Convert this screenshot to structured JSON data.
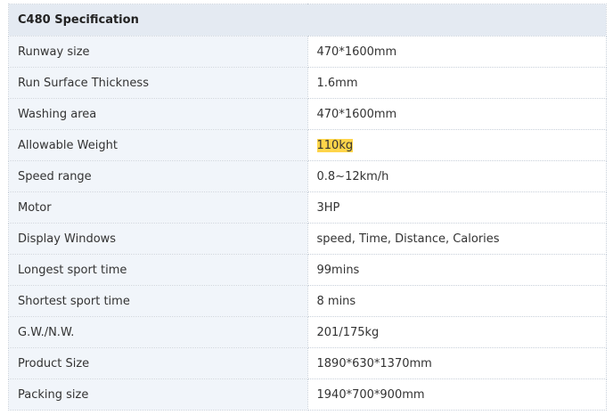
{
  "spec": {
    "title": "C480 Specification",
    "rows": [
      {
        "label": "Runway size",
        "value": "470*1600mm"
      },
      {
        "label": "Run Surface Thickness",
        "value": "1.6mm"
      },
      {
        "label": "Washing area",
        "value": "470*1600mm"
      },
      {
        "label": "Allowable Weight",
        "value": "110kg",
        "highlight": true
      },
      {
        "label": "Speed range",
        "value": "0.8~12km/h"
      },
      {
        "label": "Motor",
        "value": "3HP"
      },
      {
        "label": "Display Windows",
        "value": "speed, Time, Distance, Calories"
      },
      {
        "label": "Longest sport time",
        "value": "99mins"
      },
      {
        "label": "Shortest sport time",
        "value": "8 mins"
      },
      {
        "label": "G.W./N.W.",
        "value": "201/175kg"
      },
      {
        "label": "Product Size",
        "value": "1890*630*1370mm"
      },
      {
        "label": "Packing size",
        "value": "1940*700*900mm"
      }
    ]
  },
  "colors": {
    "header_bg": "#e4eaf2",
    "label_bg": "#f1f5fa",
    "highlight": "#ffd54a",
    "border": "#c8d0da"
  }
}
